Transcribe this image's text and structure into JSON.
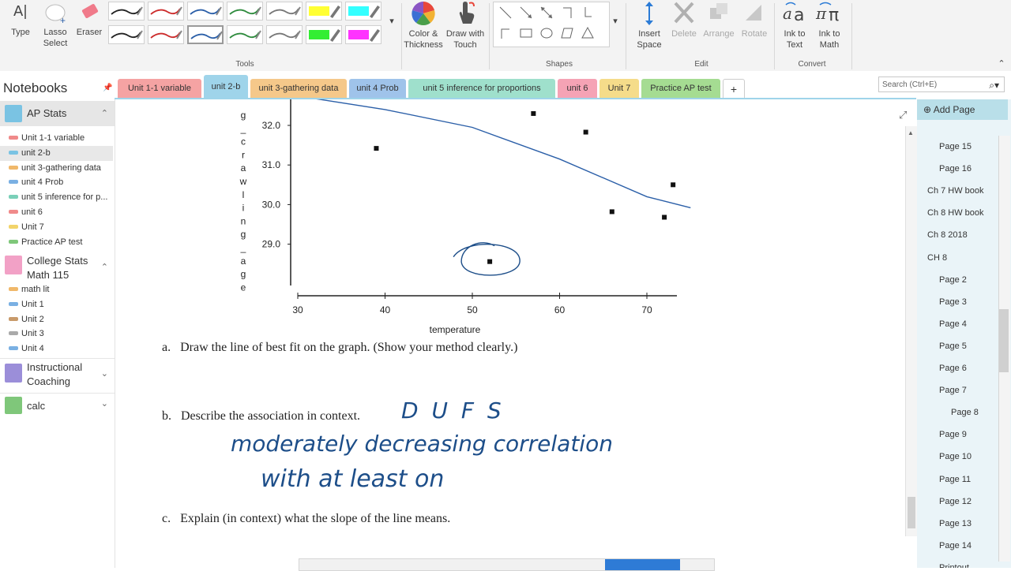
{
  "ribbon": {
    "type_label": "Type",
    "lasso_label": "Lasso Select",
    "eraser_label": "Eraser",
    "tools_group": "Tools",
    "color_label": "Color & Thickness",
    "touch_label": "Draw with Touch",
    "shapes_group": "Shapes",
    "insert_space_label": "Insert Space",
    "delete_label": "Delete",
    "arrange_label": "Arrange",
    "rotate_label": "Rotate",
    "edit_group": "Edit",
    "ink_text_label": "Ink to Text",
    "ink_math_label": "Ink to Math",
    "convert_group": "Convert",
    "pens": [
      {
        "color": "#222222"
      },
      {
        "color": "#cc2b2b"
      },
      {
        "color": "#2b5fa8"
      },
      {
        "color": "#2e8b3d"
      },
      {
        "color": "#777777"
      },
      {
        "color": "#ffff33"
      },
      {
        "color": "#33ffff"
      },
      {
        "color": "#222222"
      },
      {
        "color": "#cc2b2b"
      },
      {
        "color": "#2b5fa8"
      },
      {
        "color": "#2e8b3d"
      },
      {
        "color": "#777777"
      },
      {
        "color": "#33ee33"
      },
      {
        "color": "#ff33ff"
      }
    ]
  },
  "nav": {
    "header": "Notebooks",
    "notebooks": [
      {
        "name": "AP Stats",
        "color": "#7ac3e3"
      },
      {
        "name": "College Stats Math 115",
        "line1": "College Stats",
        "line2": "Math 115",
        "color": "#f2a1c6"
      },
      {
        "name": "Instructional Coaching",
        "line1": "Instructional",
        "line2": "Coaching",
        "color": "#9b8ed9"
      },
      {
        "name": "calc",
        "color": "#7fc77a"
      }
    ],
    "ap_sections": [
      {
        "label": "Unit 1-1 variable",
        "color": "#f08a8a"
      },
      {
        "label": "unit 2-b",
        "color": "#7ac3e3"
      },
      {
        "label": "unit 3-gathering data",
        "color": "#f0b86a"
      },
      {
        "label": "unit 4 Prob",
        "color": "#7ab0e3"
      },
      {
        "label": "unit 5 inference for p...",
        "color": "#7ad0b8"
      },
      {
        "label": "unit 6",
        "color": "#f08a8a"
      },
      {
        "label": "Unit 7",
        "color": "#f2d46a"
      },
      {
        "label": "Practice AP test",
        "color": "#7fc77a"
      }
    ],
    "college_sections": [
      {
        "label": "math lit",
        "color": "#f0b86a"
      },
      {
        "label": "Unit 1",
        "color": "#7ab0e3"
      },
      {
        "label": "Unit 2",
        "color": "#c89a6a"
      },
      {
        "label": "Unit 3",
        "color": "#aaaaaa"
      },
      {
        "label": "Unit 4",
        "color": "#7ab0e3"
      }
    ]
  },
  "tabs": [
    {
      "label": "Unit 1-1 variable",
      "color": "#f5a3a3"
    },
    {
      "label": "unit 2-b",
      "color": "#9fd4ea"
    },
    {
      "label": "unit 3-gathering data",
      "color": "#f5c88a"
    },
    {
      "label": "unit 4 Prob",
      "color": "#9fc3ea"
    },
    {
      "label": "unit 5 inference for proportions",
      "color": "#9fe0cc"
    },
    {
      "label": "unit 6",
      "color": "#f5a3b5"
    },
    {
      "label": "Unit 7",
      "color": "#f5dc8a"
    },
    {
      "label": "Practice AP test",
      "color": "#a5dc92"
    },
    {
      "label": "+",
      "color": "#ffffff"
    }
  ],
  "search": {
    "placeholder": "Search (Ctrl+E)"
  },
  "content": {
    "y_axis_letters": [
      "g",
      "_",
      "c",
      "r",
      "a",
      "w",
      "l",
      "i",
      "n",
      "g",
      "_",
      "a",
      "g",
      "e"
    ],
    "q_a": "a.   Draw the line of best fit on the graph. (Show your method clearly.)",
    "q_b": "b.   Describe the association in context.",
    "q_c": "c.   Explain (in context) what the slope of the line means.",
    "ink_1": "D U F S",
    "ink_2": "moderately decreasing correlation",
    "ink_3": "with at least on"
  },
  "chart_data": {
    "type": "scatter",
    "xlabel": "temperature",
    "ylabel": "",
    "xlim": [
      30,
      73
    ],
    "ylim": [
      28.0,
      32.3
    ],
    "x_ticks": [
      30,
      40,
      50,
      60,
      70
    ],
    "y_ticks": [
      29.0,
      30.0,
      31.0,
      32.0
    ],
    "points": [
      {
        "x": 39,
        "y": 31.42
      },
      {
        "x": 52,
        "y": 28.56
      },
      {
        "x": 57,
        "y": 32.3
      },
      {
        "x": 63,
        "y": 31.83
      },
      {
        "x": 66,
        "y": 29.82
      },
      {
        "x": 72,
        "y": 29.68
      },
      {
        "x": 73,
        "y": 30.5
      }
    ],
    "fit_line": [
      {
        "x": 31.3,
        "y": 32.7
      },
      {
        "x": 40,
        "y": 32.4
      },
      {
        "x": 50,
        "y": 31.95
      },
      {
        "x": 60,
        "y": 31.15
      },
      {
        "x": 70,
        "y": 30.2
      },
      {
        "x": 75,
        "y": 29.92
      }
    ],
    "circled_point_index": 1
  },
  "pages": [
    "Page 15",
    "Page 16",
    "Ch 7 HW book",
    "Ch 8 HW book",
    "Ch 8 2018",
    "CH 8",
    "Page 2",
    "Page 3",
    "Page 4",
    "Page 5",
    "Page 6",
    "Page 7",
    "Page 8",
    "Page 9",
    "Page 10",
    "Page 11",
    "Page 12",
    "Page 13",
    "Page 14",
    "Printout"
  ],
  "add_page_label": "Add Page"
}
